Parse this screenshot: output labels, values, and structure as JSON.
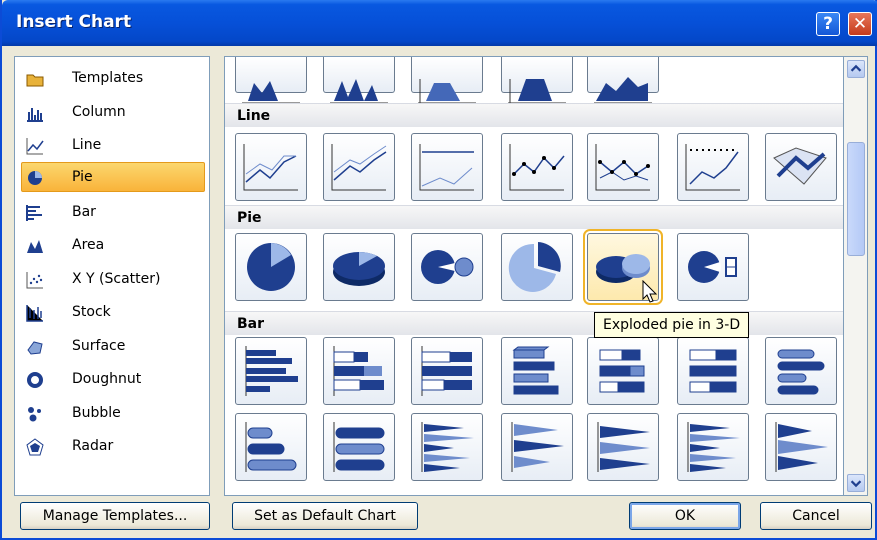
{
  "window": {
    "title": "Insert Chart",
    "help": "?",
    "close": "✕"
  },
  "chart_types": [
    {
      "label": "Templates",
      "icon": "folder-icon"
    },
    {
      "label": "Column",
      "icon": "column-chart-icon"
    },
    {
      "label": "Line",
      "icon": "line-chart-icon"
    },
    {
      "label": "Pie",
      "icon": "pie-chart-icon"
    },
    {
      "label": "Bar",
      "icon": "bar-chart-icon"
    },
    {
      "label": "Area",
      "icon": "area-chart-icon"
    },
    {
      "label": "X Y (Scatter)",
      "icon": "scatter-chart-icon"
    },
    {
      "label": "Stock",
      "icon": "stock-chart-icon"
    },
    {
      "label": "Surface",
      "icon": "surface-chart-icon"
    },
    {
      "label": "Doughnut",
      "icon": "doughnut-chart-icon"
    },
    {
      "label": "Bubble",
      "icon": "bubble-chart-icon"
    },
    {
      "label": "Radar",
      "icon": "radar-chart-icon"
    }
  ],
  "selected_type": "Pie",
  "sections": {
    "line": "Line",
    "pie": "Pie",
    "bar": "Bar"
  },
  "tooltip": "Exploded pie in 3-D",
  "buttons": {
    "manage_templates": "Manage Templates...",
    "set_default": "Set as Default Chart",
    "ok": "OK",
    "cancel": "Cancel"
  },
  "colors": {
    "accent": "#0650d8",
    "selection": "#f9b33a",
    "chart_fill": "#1f3f8f"
  }
}
